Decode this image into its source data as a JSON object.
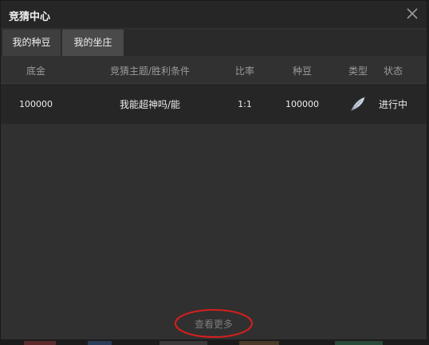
{
  "window": {
    "title": "竞猜中心"
  },
  "tabs": [
    {
      "label": "我的种豆"
    },
    {
      "label": "我的坐庄"
    }
  ],
  "table": {
    "headers": [
      "底金",
      "竞猜主题/胜利条件",
      "比率",
      "种豆",
      "类型",
      "状态"
    ],
    "rows": [
      {
        "base": "100000",
        "topic": "我能超神吗/能",
        "ratio": "1:1",
        "beans": "100000",
        "type_icon": "feather-icon",
        "status": "进行中"
      }
    ]
  },
  "footer": {
    "more_label": "查看更多"
  },
  "colors": {
    "window_bg": "#303030",
    "titlebar_bg": "#262626",
    "row_bg": "#262626",
    "annotation": "#d81e1e"
  }
}
